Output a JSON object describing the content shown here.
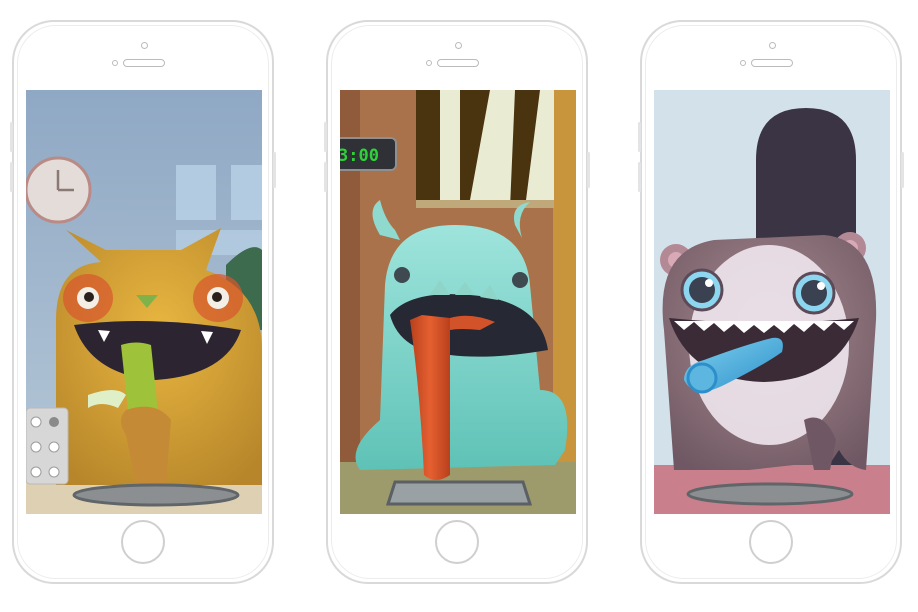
{
  "screens": [
    {
      "character": "cat",
      "object": "clock",
      "extra": "pill pack"
    },
    {
      "character": "ghost",
      "timer_text": "3:00"
    },
    {
      "character": "bear"
    }
  ]
}
